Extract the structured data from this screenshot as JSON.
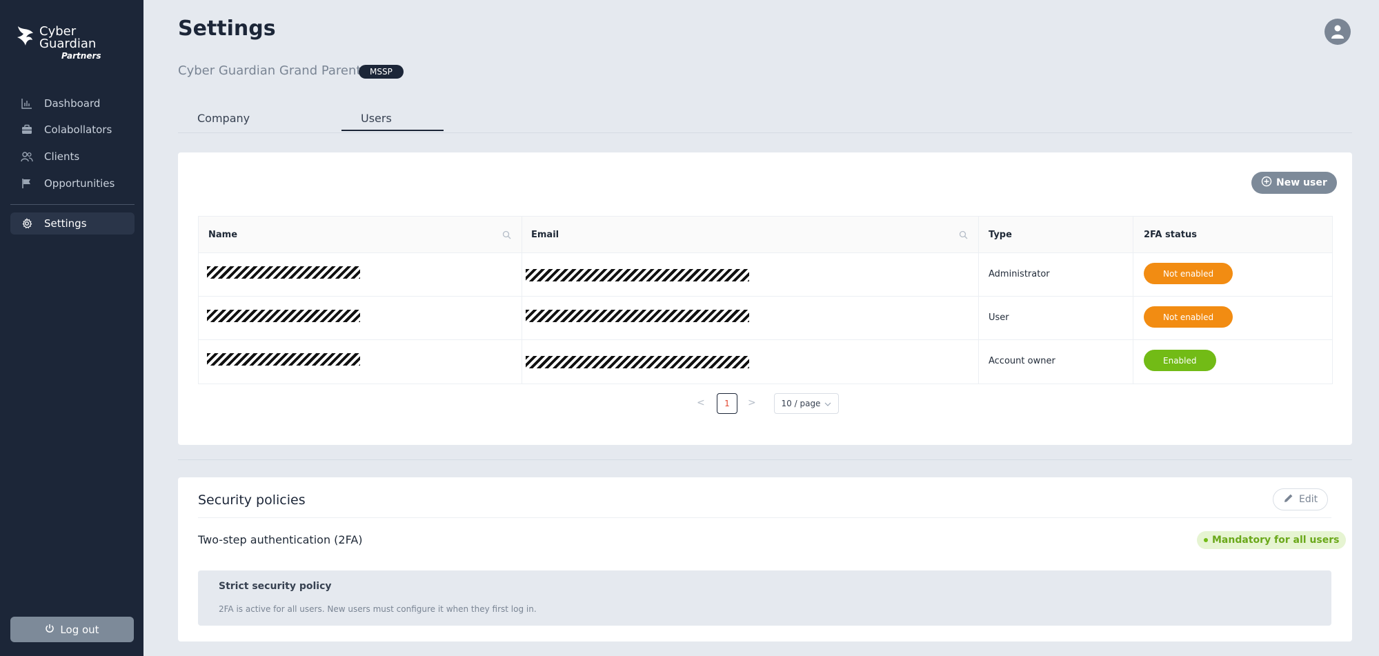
{
  "brand": {
    "line1": "Cyber",
    "line2": "Guardian",
    "line3": "Partners"
  },
  "sidebar": {
    "items": [
      {
        "label": "Dashboard",
        "icon": "bar-chart-icon"
      },
      {
        "label": "Colabollators",
        "icon": "briefcase-icon"
      },
      {
        "label": "Clients",
        "icon": "users-icon"
      },
      {
        "label": "Opportunities",
        "icon": "flag-icon"
      },
      {
        "label": "Settings",
        "icon": "gear-icon"
      }
    ],
    "logout_label": "Log out"
  },
  "header": {
    "title": "Settings",
    "org_name": "Cyber Guardian Grand Parent",
    "org_badge": "MSSP"
  },
  "tabs": [
    {
      "label": "Company"
    },
    {
      "label": "Users",
      "active": true
    }
  ],
  "users": {
    "new_user_label": "New user",
    "columns": [
      "Name",
      "Email",
      "Type",
      "2FA status"
    ],
    "rows": [
      {
        "type": "Administrator",
        "status": "Not enabled",
        "status_color": "#f28c12"
      },
      {
        "type": "User",
        "status": "Not enabled",
        "status_color": "#f28c12"
      },
      {
        "type": "Account owner",
        "status": "Enabled",
        "status_color": "#72bb16"
      }
    ],
    "pagination": {
      "prev": "<",
      "current": "1",
      "next": ">",
      "page_size": "10 / page"
    }
  },
  "security": {
    "title": "Security policies",
    "edit_label": "Edit",
    "twofa_label": "Two-step authentication (2FA)",
    "twofa_badge": "Mandatory for all users",
    "policy_title": "Strict security policy",
    "policy_desc": "2FA is active for all users. New users must configure it when they first log in."
  },
  "colors": {
    "sidebar_bg": "#1c2638",
    "page_bg": "#e5e9ef",
    "warning": "#f28c12",
    "success": "#72bb16",
    "button_gray": "#7d8a99"
  }
}
